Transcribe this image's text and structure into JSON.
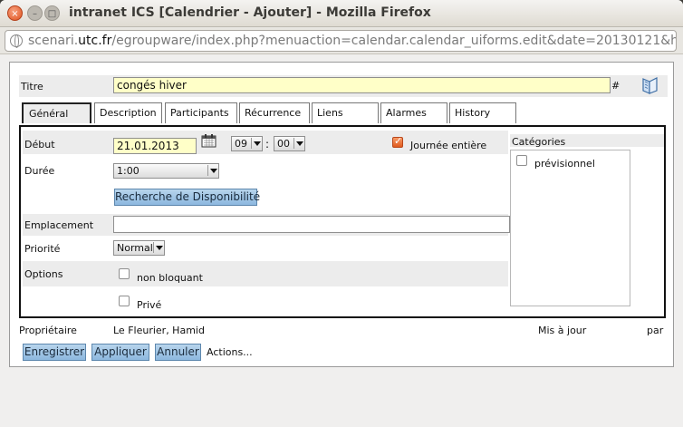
{
  "window": {
    "title": "intranet ICS [Calendrier - Ajouter] - Mozilla Firefox",
    "close_icon": "×",
    "minimize_icon": "–",
    "maximize_icon": "□"
  },
  "urlbar": {
    "prefix": "scenari.",
    "domain": "utc.fr",
    "path": "/egroupware/index.php?menuaction=calendar.calendar_uiforms.edit&date=20130121&ho"
  },
  "form": {
    "title_label": "Titre",
    "title_value": "congés hiver",
    "hash": "#",
    "tabs": [
      {
        "label": "Général"
      },
      {
        "label": "Description"
      },
      {
        "label": "Participants"
      },
      {
        "label": "Récurrence"
      },
      {
        "label": "Liens"
      },
      {
        "label": "Alarmes"
      },
      {
        "label": "History"
      }
    ],
    "start_label": "Début",
    "start_date": "21.01.2013",
    "start_hour": "09",
    "time_sep": ":",
    "start_minute": "00",
    "whole_day_label": "Journée entière",
    "whole_day_checked": true,
    "duration_label": "Durée",
    "duration_value": "1:00",
    "availability_button": "Recherche de Disponibilité",
    "location_label": "Emplacement",
    "location_value": "",
    "priority_label": "Priorité",
    "priority_value": "Normal",
    "options_label": "Options",
    "non_blocking_label": "non bloquant",
    "private_label": "Privé",
    "categories_label": "Catégories",
    "categories": [
      {
        "label": "prévisionnel",
        "checked": false
      }
    ],
    "owner_label": "Propriétaire",
    "owner_value": "Le Fleurier, Hamid",
    "updated_label": "Mis à jour",
    "by_label": "par",
    "buttons": {
      "save": "Enregistrer",
      "apply": "Appliquer",
      "cancel": "Annuler"
    },
    "actions_label": "Actions..."
  },
  "colors": {
    "button": "#9cc3e6",
    "input_highlight": "#ffffc8",
    "checkbox_checked": "#e05a1d"
  }
}
